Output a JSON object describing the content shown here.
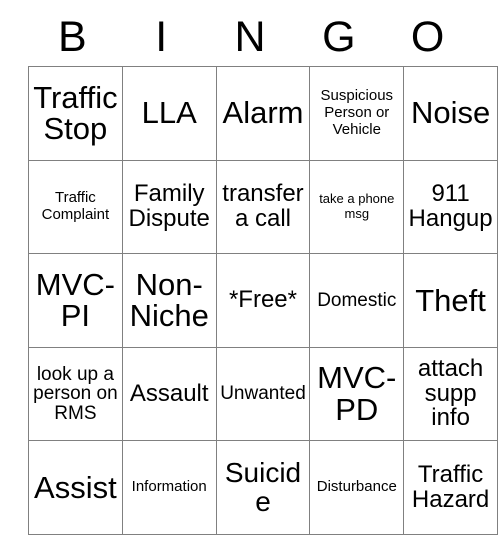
{
  "card": {
    "headers": [
      "B",
      "I",
      "N",
      "G",
      "O"
    ],
    "rows": [
      [
        {
          "text": "Traffic Stop",
          "size": "fs-xl"
        },
        {
          "text": "LLA",
          "size": "fs-xl"
        },
        {
          "text": "Alarm",
          "size": "fs-xl"
        },
        {
          "text": "Suspicious Person or Vehicle",
          "size": "fs-xs"
        },
        {
          "text": "Noise",
          "size": "fs-xl"
        }
      ],
      [
        {
          "text": "Traffic Complaint",
          "size": "fs-xs"
        },
        {
          "text": "Family Dispute",
          "size": "fs-md"
        },
        {
          "text": "transfer a call",
          "size": "fs-md"
        },
        {
          "text": "take a phone msg",
          "size": "fs-xxs"
        },
        {
          "text": "911 Hangup",
          "size": "fs-md"
        }
      ],
      [
        {
          "text": "MVC-PI",
          "size": "fs-xl"
        },
        {
          "text": "Non-Niche",
          "size": "fs-xl"
        },
        {
          "text": "*Free*",
          "size": "fs-md"
        },
        {
          "text": "Domestic",
          "size": "fs-sm"
        },
        {
          "text": "Theft",
          "size": "fs-xl"
        }
      ],
      [
        {
          "text": "look up a person on RMS",
          "size": "fs-sm"
        },
        {
          "text": "Assault",
          "size": "fs-md"
        },
        {
          "text": "Unwanted",
          "size": "fs-sm"
        },
        {
          "text": "MVC-PD",
          "size": "fs-xl"
        },
        {
          "text": "attach supp info",
          "size": "fs-md"
        }
      ],
      [
        {
          "text": "Assist",
          "size": "fs-xl"
        },
        {
          "text": "Information",
          "size": "fs-xs"
        },
        {
          "text": "Suicide",
          "size": "fs-lg"
        },
        {
          "text": "Disturbance",
          "size": "fs-xs"
        },
        {
          "text": "Traffic Hazard",
          "size": "fs-md"
        }
      ]
    ]
  }
}
